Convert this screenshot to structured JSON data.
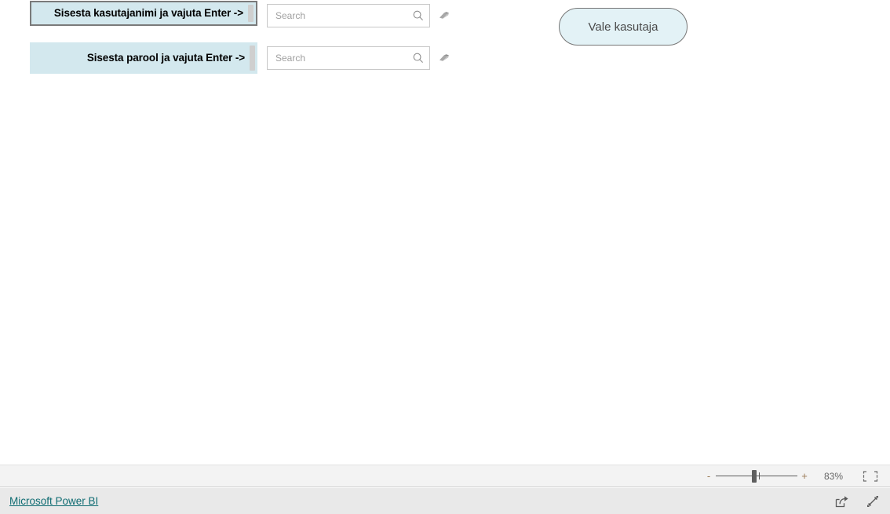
{
  "report": {
    "zoom_bar": {
      "minus_label": "-",
      "plus_label": "+",
      "zoom_level": "83%",
      "zoom_slider_value": 44,
      "fit_icon": "fit-to-page-icon"
    },
    "footer": {
      "brand_link": "Microsoft Power BI",
      "share_icon": "share-icon",
      "fullscreen_icon": "fullscreen-icon"
    }
  },
  "slicers": [
    {
      "id": "username",
      "label": "Sisesta kasutajanimi ja vajuta Enter ->",
      "selected": true,
      "scrollbar": true
    },
    {
      "id": "password",
      "label": "Sisesta parool ja vajuta Enter ->",
      "selected": false,
      "scrollbar": true
    }
  ],
  "search_fields": [
    {
      "id": "username-search",
      "value": "",
      "placeholder": "Search",
      "icon": "search-icon",
      "clear_icon": "eraser-icon"
    },
    {
      "id": "password-search",
      "value": "",
      "placeholder": "Search",
      "icon": "search-icon",
      "clear_icon": "eraser-icon"
    }
  ],
  "buttons": {
    "wrong_user": {
      "label": "Vale kasutaja"
    }
  },
  "colors": {
    "slicer_background": "#d3e8ee",
    "pill_background": "#e3f2f6",
    "pill_border": "#767676",
    "brand_link": "#0f6c72",
    "canvas": "#ffffff",
    "zoombar": "#f3f3f3",
    "footer": "#e9e9e9"
  }
}
